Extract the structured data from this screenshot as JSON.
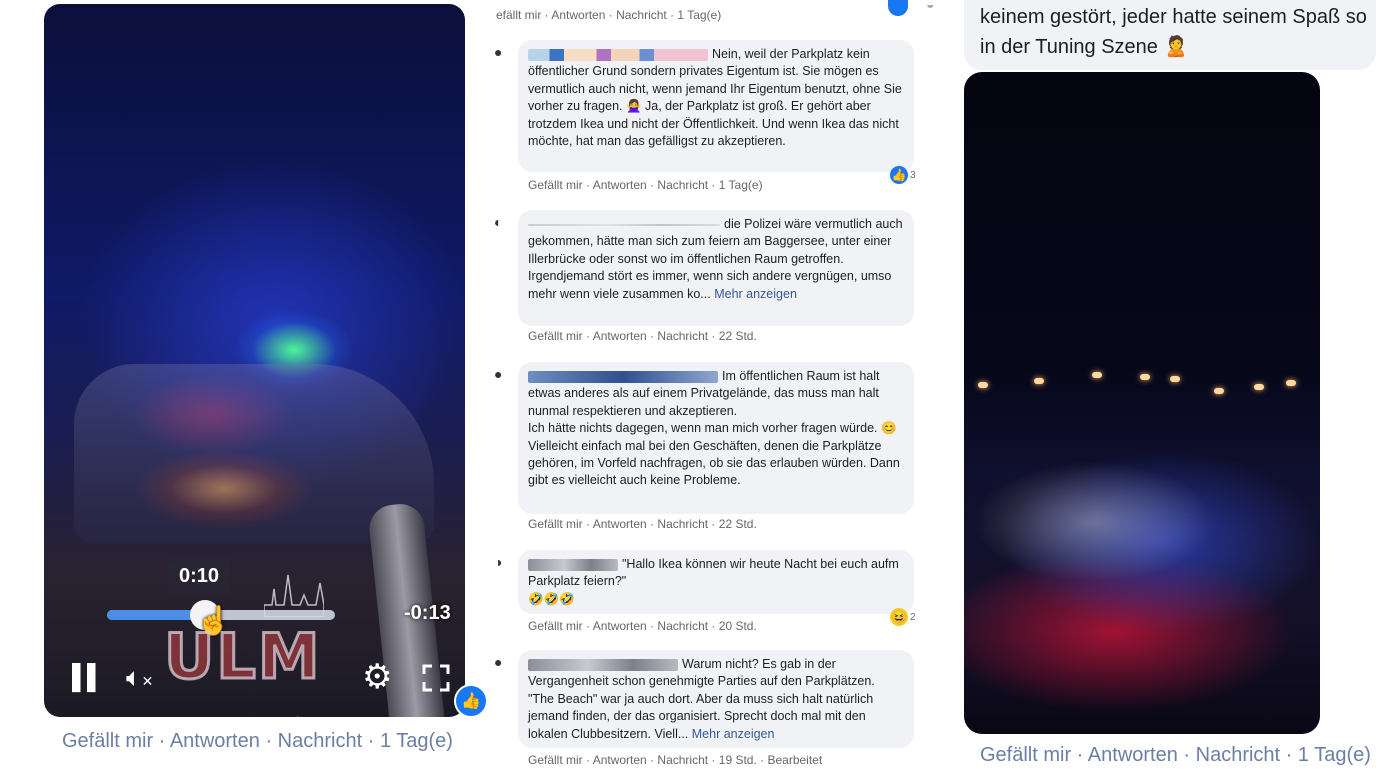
{
  "left_video": {
    "current_time": "0:10",
    "remaining_time": "-0:13",
    "progress_fraction": 0.43,
    "watermark": "ULM",
    "controls": {
      "pause_icon": "pause-icon",
      "mute_icon": "volume-muted-icon",
      "settings_icon": "gear-icon",
      "fullscreen_icon": "fullscreen-icon"
    }
  },
  "left_actions": {
    "like": "Gefällt mir",
    "reply": "Antworten",
    "message": "Nachricht",
    "time": "1 Tag(e)",
    "sep": "·"
  },
  "mid": {
    "top_actions": {
      "like": "efällt mir",
      "reply": "Antworten",
      "message": "Nachricht",
      "time": "1 Tag(e)"
    },
    "comments": [
      {
        "text": "Nein, weil der Parkplatz kein öffentlicher Grund sondern privates Eigentum ist. Sie mögen es vermutlich auch nicht, wenn jemand Ihr Eigentum benutzt, ohne Sie vorher zu fragen. 🙅‍♀️ Ja, der Parkplatz ist groß. Er gehört aber trotzdem Ikea und nicht der Öffentlichkeit. Und wenn Ikea das nicht möchte, hat man das gefälligst zu akzeptieren.",
        "more": "",
        "actions": {
          "like": "Gefällt mir",
          "reply": "Antworten",
          "message": "Nachricht",
          "time": "1 Tag(e)"
        },
        "reaction_count": "3"
      },
      {
        "text": "die Polizei wäre vermutlich auch gekommen, hätte man sich zum feiern am Baggersee, unter einer Illerbrücke oder sonst wo im öffentlichen Raum getroffen. Irgendjemand stört es immer, wenn sich andere vergnügen, umso mehr wenn viele zusammen ko...",
        "more": "Mehr anzeigen",
        "actions": {
          "like": "Gefällt mir",
          "reply": "Antworten",
          "message": "Nachricht",
          "time": "22 Std."
        },
        "reaction_count": ""
      },
      {
        "text": "Im öffentlichen Raum ist halt etwas anderes als auf einem Privatgelände, das muss man halt nunmal respektieren und akzeptieren.\nIch hätte nichts dagegen, wenn man mich vorher fragen würde. 😊 Vielleicht einfach mal bei den Geschäften, denen die Parkplätze gehören, im Vorfeld nachfragen, ob sie das erlauben würden. Dann gibt es vielleicht auch keine Probleme.",
        "more": "",
        "actions": {
          "like": "Gefällt mir",
          "reply": "Antworten",
          "message": "Nachricht",
          "time": "22 Std."
        },
        "reaction_count": ""
      },
      {
        "text": "\"Hallo Ikea können wir heute Nacht bei euch aufm Parkplatz feiern?\"\n🤣🤣🤣",
        "more": "",
        "actions": {
          "like": "Gefällt mir",
          "reply": "Antworten",
          "message": "Nachricht",
          "time": "20 Std."
        },
        "reaction_count": "2"
      },
      {
        "text": "Warum nicht? Es gab in der Vergangenheit schon genehmigte Parties auf den Parkplätzen. \"The Beach\" war ja auch dort. Aber da muss sich halt natürlich jemand finden, der das organisiert. Sprecht doch mal mit den lokalen Clubbesitzern. Viell...",
        "more": "Mehr anzeigen",
        "actions": {
          "like": "Gefällt mir",
          "reply": "Antworten",
          "message": "Nachricht",
          "time": "19 Std.",
          "extra": "Bearbeitet"
        },
        "reaction_count": ""
      }
    ]
  },
  "right": {
    "text": "keinem gestört, jeder hatte seinem Spaß so in der Tuning Szene 🙎",
    "actions": {
      "like": "Gefällt mir",
      "reply": "Antworten",
      "message": "Nachricht",
      "time": "1 Tag(e)"
    }
  },
  "colors": {
    "fb_blue": "#1877f2",
    "link": "#385898",
    "bubble": "#f0f2f5",
    "meta": "#65676b"
  }
}
